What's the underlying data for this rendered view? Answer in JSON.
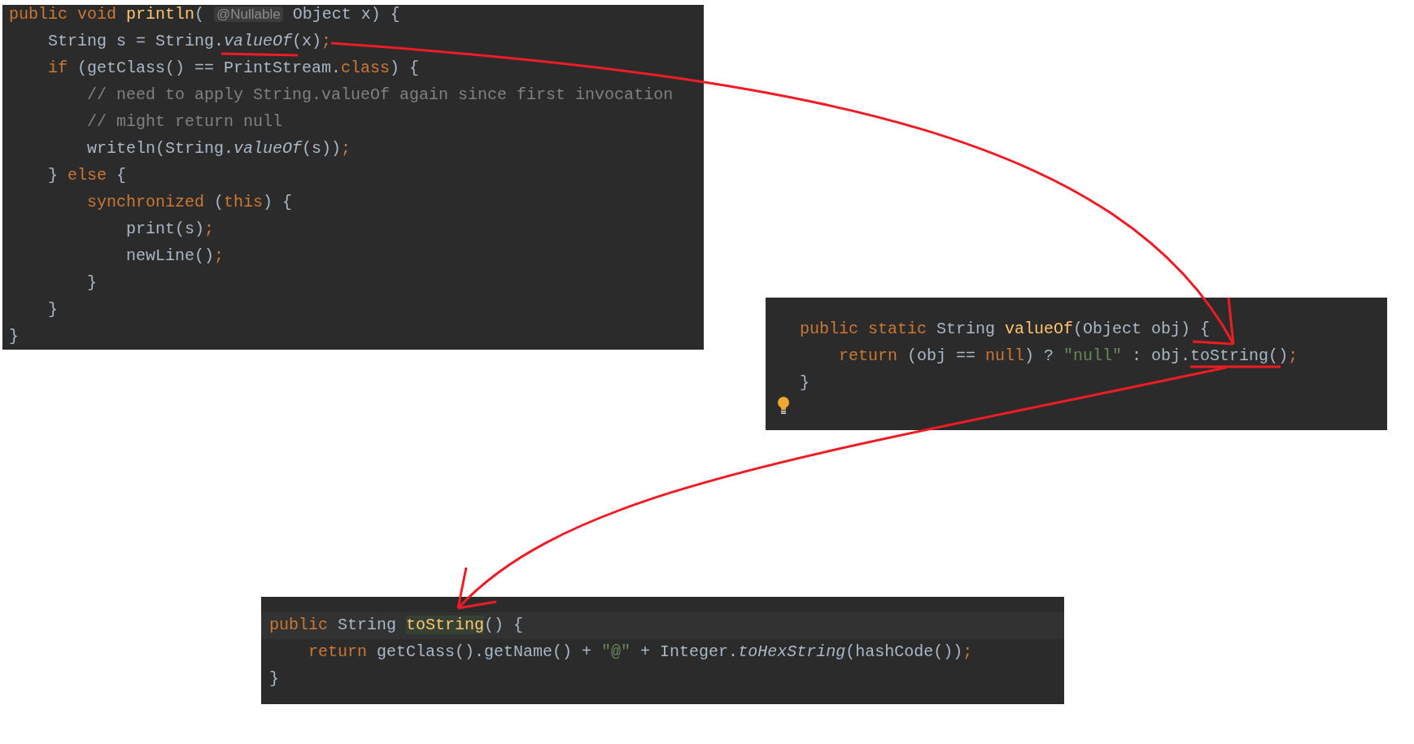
{
  "panels": [
    {
      "kind": "caller",
      "bulb": false,
      "lines": [
        [
          {
            "text": "public void ",
            "kind": "keyword"
          },
          {
            "text": "println",
            "kind": "decl"
          },
          {
            "text": "( ",
            "kind": "plain"
          },
          {
            "text": "@Nullable",
            "kind": "inlay"
          },
          {
            "text": " Object x) {",
            "kind": "plain"
          }
        ],
        [
          {
            "text": "    String s = String.",
            "kind": "plain"
          },
          {
            "text": "valueOf",
            "kind": "static"
          },
          {
            "text": "(x)",
            "kind": "plain"
          },
          {
            "text": ";",
            "kind": "keyword"
          }
        ],
        [
          {
            "text": "    if ",
            "kind": "keyword"
          },
          {
            "text": "(getClass() == PrintStream.",
            "kind": "plain"
          },
          {
            "text": "class",
            "kind": "keyword"
          },
          {
            "text": ") {",
            "kind": "plain"
          }
        ],
        [
          {
            "text": "        // need to apply String.valueOf again since first invocation",
            "kind": "comment"
          }
        ],
        [
          {
            "text": "        // might return null",
            "kind": "comment"
          }
        ],
        [
          {
            "text": "        writeln(String.",
            "kind": "plain"
          },
          {
            "text": "valueOf",
            "kind": "static"
          },
          {
            "text": "(s))",
            "kind": "plain"
          },
          {
            "text": ";",
            "kind": "keyword"
          }
        ],
        [
          {
            "text": "    } ",
            "kind": "plain"
          },
          {
            "text": "else ",
            "kind": "keyword"
          },
          {
            "text": "{",
            "kind": "plain"
          }
        ],
        [
          {
            "text": "        synchronized ",
            "kind": "keyword"
          },
          {
            "text": "(",
            "kind": "plain"
          },
          {
            "text": "this",
            "kind": "keyword"
          },
          {
            "text": ") {",
            "kind": "plain"
          }
        ],
        [
          {
            "text": "            print(s)",
            "kind": "plain"
          },
          {
            "text": ";",
            "kind": "keyword"
          }
        ],
        [
          {
            "text": "            newLine()",
            "kind": "plain"
          },
          {
            "text": ";",
            "kind": "keyword"
          }
        ],
        [
          {
            "text": "        }",
            "kind": "plain"
          }
        ],
        [
          {
            "text": "    }",
            "kind": "plain"
          }
        ],
        [
          {
            "text": "}",
            "kind": "plain"
          }
        ]
      ]
    },
    {
      "kind": "value_of",
      "bulb": true,
      "lines": [
        [
          {
            "text": "public static ",
            "kind": "keyword"
          },
          {
            "text": "String ",
            "kind": "plain"
          },
          {
            "text": "valueOf",
            "kind": "decl"
          },
          {
            "text": "(Object obj) {",
            "kind": "plain"
          }
        ],
        [
          {
            "text": "    return ",
            "kind": "keyword"
          },
          {
            "text": "(obj == ",
            "kind": "plain"
          },
          {
            "text": "null",
            "kind": "keyword"
          },
          {
            "text": ") ? ",
            "kind": "plain"
          },
          {
            "text": "\"null\"",
            "kind": "string"
          },
          {
            "text": " : obj.toString()",
            "kind": "plain"
          },
          {
            "text": ";",
            "kind": "keyword"
          }
        ],
        [
          {
            "text": "}",
            "kind": "plain"
          }
        ]
      ]
    },
    {
      "kind": "to_string",
      "bulb": false,
      "lines": [
        [
          {
            "text": "public ",
            "kind": "keyword"
          },
          {
            "text": "String ",
            "kind": "plain"
          },
          {
            "text": "toString",
            "kind": "match"
          },
          {
            "text": "() {",
            "kind": "plain"
          }
        ],
        [
          {
            "text": "    return ",
            "kind": "keyword"
          },
          {
            "text": "getClass().getName() + ",
            "kind": "plain"
          },
          {
            "text": "\"@\"",
            "kind": "string"
          },
          {
            "text": " + Integer.",
            "kind": "plain"
          },
          {
            "text": "toHexString",
            "kind": "static"
          },
          {
            "text": "(hashCode())",
            "kind": "plain"
          },
          {
            "text": ";",
            "kind": "keyword"
          }
        ],
        [
          {
            "text": "}",
            "kind": "plain"
          }
        ]
      ]
    }
  ]
}
